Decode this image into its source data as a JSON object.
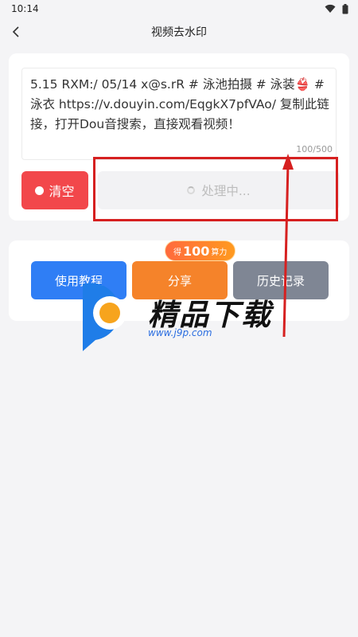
{
  "status": {
    "time": "10:14"
  },
  "appbar": {
    "title": "视频去水印"
  },
  "input": {
    "text": "5.15 RXM:/ 05/14 x@s.rR # 泳池拍摄 # 泳装👙 # 泳衣  https://v.douyin.com/EqgkX7pfVAo/ 复制此链接，打开Dou音搜索，直接观看视频！",
    "counter": "100/500"
  },
  "buttons": {
    "clear_label": "清空",
    "process_label": "处理中..."
  },
  "actions": {
    "reward_prefix": "得",
    "reward_number": "100",
    "reward_suffix": "算力",
    "tutorial_label": "使用教程",
    "share_label": "分享",
    "history_label": "历史记录"
  },
  "watermark": {
    "title": "精品下载",
    "subtitle": "www.j9p.com"
  },
  "colors": {
    "clear_button": "#f2474b",
    "tutorial_button": "#2f7ef5",
    "share_button": "#f5832a",
    "history_button": "#7f8694",
    "annotation": "#d62020"
  }
}
